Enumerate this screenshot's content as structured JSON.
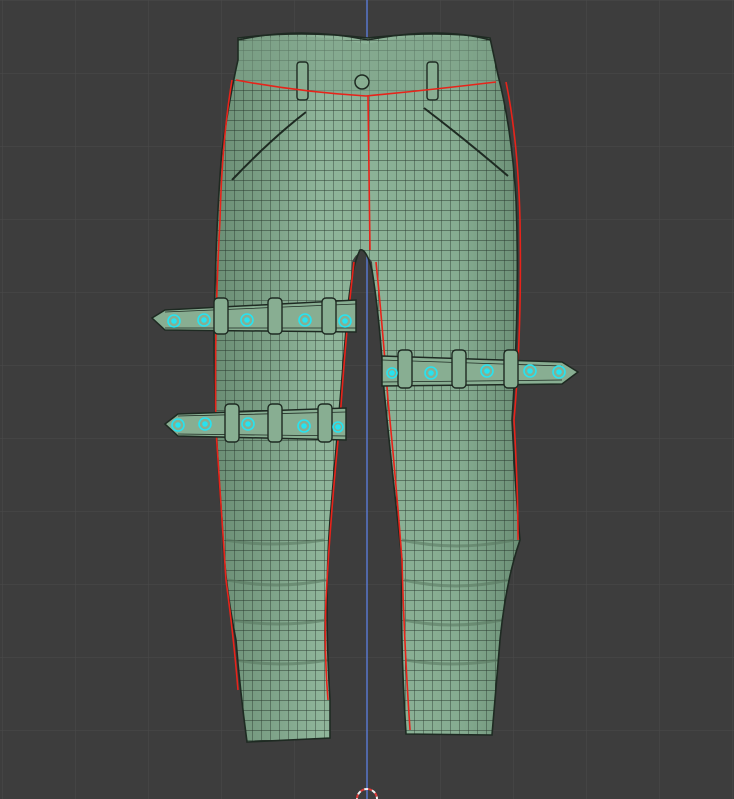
{
  "viewport": {
    "mode": "3d-viewport",
    "view": "front-orthographic",
    "object": "pants-mesh",
    "display": "wireframe-overlay",
    "icons": [
      "3d-cursor-icon"
    ]
  },
  "colors": {
    "background": "#3d3d3d",
    "grid": "#4a4a4a",
    "z_axis": "#5a7ad6",
    "mesh_fill": "#88ae92",
    "mesh_shade": "#6f937a",
    "wire": "#1e2a22",
    "seam": "#e8231a",
    "selected_vertex": "#27e3f0",
    "cursor_red": "#e03a3a",
    "cursor_white": "#f2f2f2"
  }
}
